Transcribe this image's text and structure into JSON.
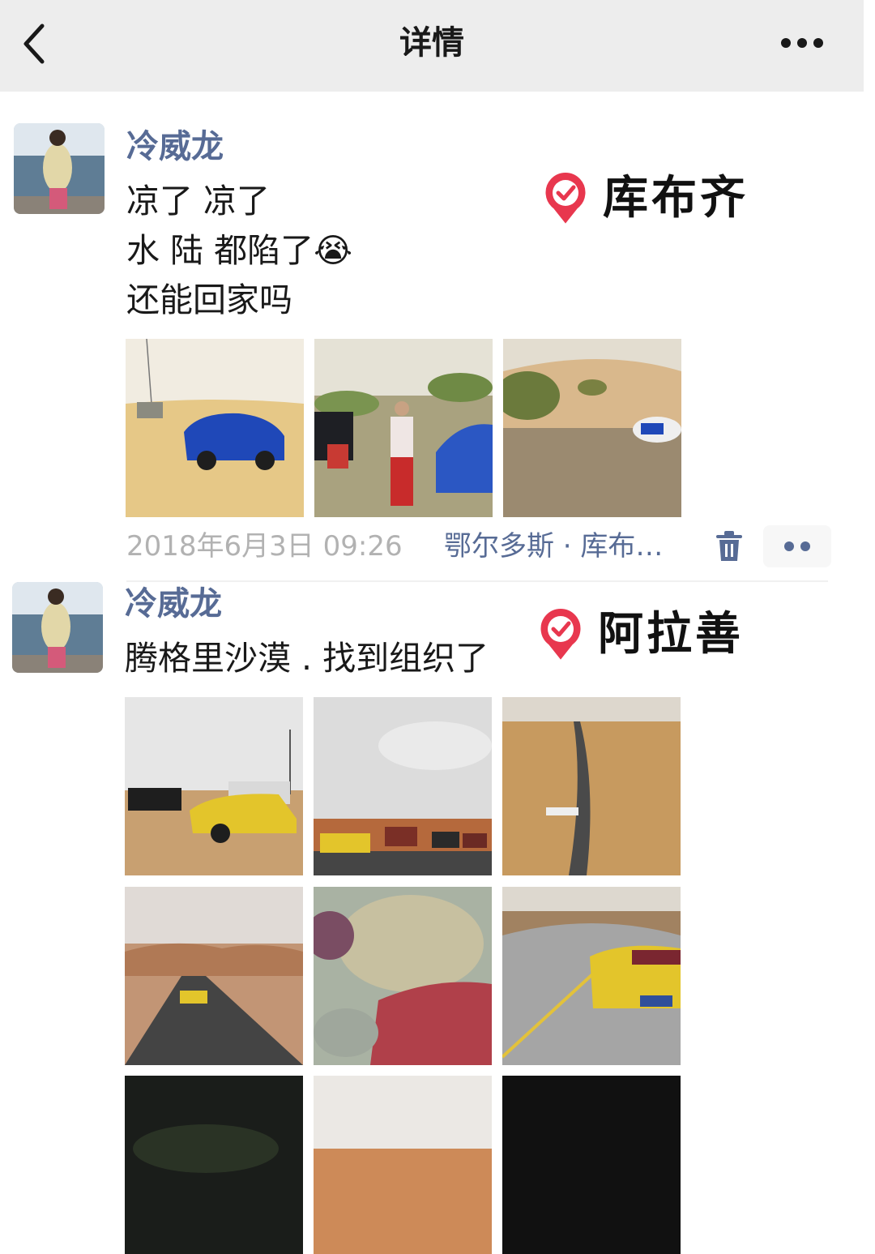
{
  "nav": {
    "title": "详情",
    "back_icon": "chevron-left-icon",
    "more_icon": "more-dots-icon"
  },
  "posts": [
    {
      "author": "冷威龙",
      "text": "凉了 凉了\n水 陆 都陷了😭\n还能回家吗",
      "time": "2018年6月3日 09:26",
      "location": "鄂尔多斯 · 库布…",
      "badge": "库布齐",
      "photos": [
        "blue-car-stuck-in-sand",
        "people-pulling-car",
        "car-splashing-water"
      ]
    },
    {
      "author": "冷威龙",
      "text": "腾格里沙漠 . 找到组织了",
      "badge": "阿拉善",
      "photos": [
        "cars-parked-desert",
        "convoy-under-cloudy-sky",
        "aerial-desert-road",
        "yellow-car-desert-road",
        "aerial-colored-lake",
        "yellow-porsche-road",
        "night-scene-1",
        "hazy-dunes",
        "night-scene-2"
      ]
    }
  ],
  "colors": {
    "nav_bg": "#ededed",
    "author": "#576b95",
    "meta_time": "#b2b2b2",
    "badge_red": "#e8374e"
  }
}
